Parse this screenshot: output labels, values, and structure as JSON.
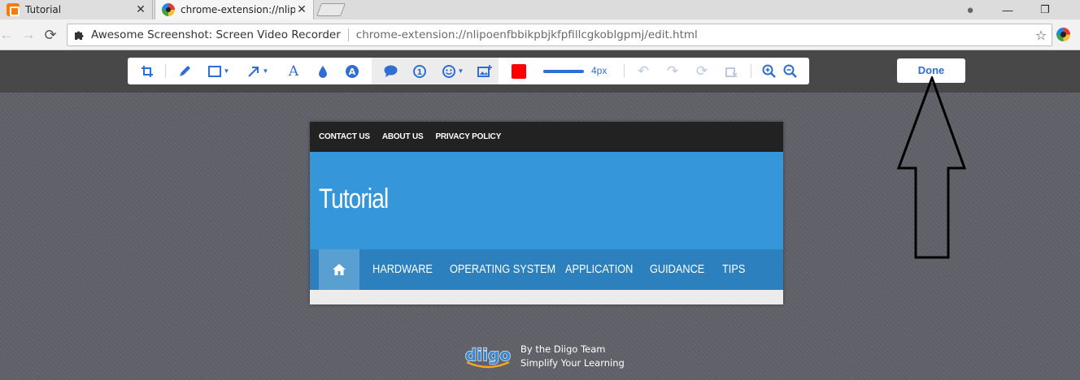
{
  "browser": {
    "tabs": [
      {
        "title": "Tutorial",
        "icon": "blogger-icon",
        "active": false
      },
      {
        "title": "chrome-extension://nlipoenfbbikpbjkfpfillcgkoblgpmj/edit.html",
        "icon": "awesome-screenshot-icon",
        "active": true
      }
    ],
    "close_glyph": "✕",
    "window_controls": {
      "profile": "●",
      "minimize": "—",
      "restore": "❐"
    },
    "nav": {
      "back": "←",
      "forward": "→",
      "reload": "⟳"
    },
    "omnibox": {
      "site_name": "Awesome Screenshot: Screen Video Recorder",
      "url": "chrome-extension://nlipoenfbbikpbjkfpfillcgkoblgpmj/edit.html",
      "star": "☆"
    }
  },
  "editor": {
    "tools": [
      "crop-icon",
      "pen-icon",
      "rectangle-icon",
      "arrow-icon",
      "text-icon",
      "blur-icon",
      "highlight-text-icon",
      "speech-bubble-icon",
      "step-number-icon",
      "emoji-icon",
      "image-insert-icon",
      "undo-icon",
      "redo-icon",
      "reset-icon",
      "clear-icon",
      "zoom-in-icon",
      "zoom-out-icon"
    ],
    "color": "#ff0000",
    "line_width_label": "4px",
    "done_label": "Done",
    "accent": "#2f6ed3"
  },
  "screenshot": {
    "top_links": [
      "CONTACT US",
      "ABOUT US",
      "PRIVACY POLICY"
    ],
    "blog_title": "Tutorial",
    "menu": [
      "HARDWARE",
      "OPERATING SYSTEM",
      "APPLICATION",
      "GUIDANCE",
      "TIPS"
    ],
    "header_color": "#3597d9",
    "menu_color": "#2c80bd"
  },
  "footer": {
    "logo_text": "diigo",
    "line1": "By the Diigo Team",
    "line2": "Simplify Your Learning"
  }
}
